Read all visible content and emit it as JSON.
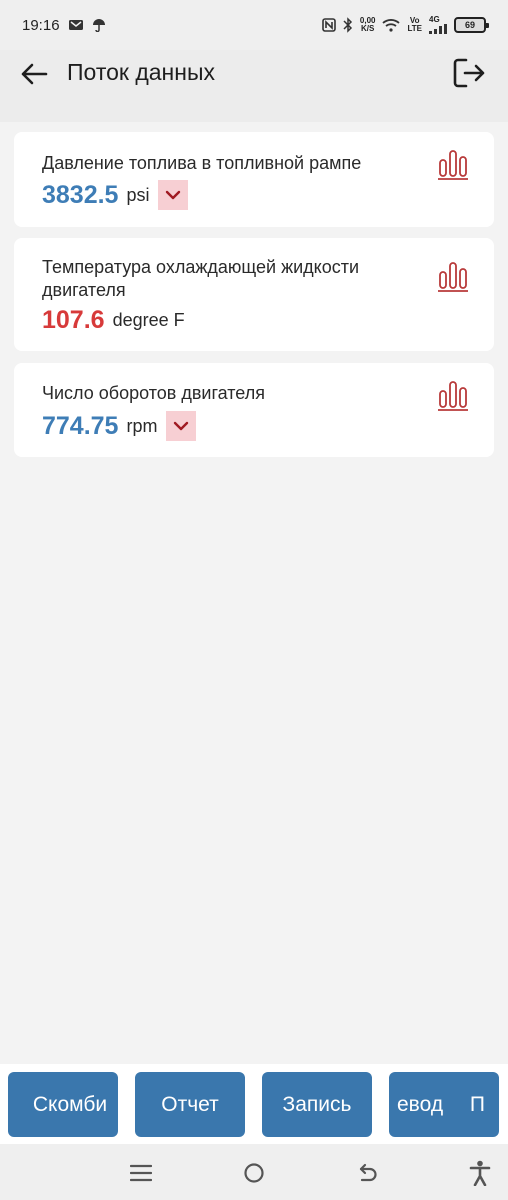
{
  "status_bar": {
    "time": "19:16",
    "net_speed_value": "0,00",
    "net_speed_unit": "K/S",
    "volte_top": "Vo",
    "volte_bottom": "LTE",
    "network": "4G",
    "battery": "69"
  },
  "header": {
    "title": "Поток данных"
  },
  "cards": [
    {
      "title": "Давление топлива в топливной рампе",
      "value": "3832.5",
      "unit": "psi",
      "value_color": "#3e7db6",
      "has_dropdown": true
    },
    {
      "title": "Температура охлаждающей жидкости двигателя",
      "value": "107.6",
      "unit": "degree F",
      "value_color": "#d73a3a",
      "has_dropdown": false
    },
    {
      "title": "Число оборотов двигателя",
      "value": "774.75",
      "unit": "rpm",
      "value_color": "#3e7db6",
      "has_dropdown": true
    }
  ],
  "bottom_buttons": {
    "combine": "Скомби",
    "report": "Отчет",
    "record": "Запись",
    "translate": "евод",
    "next": "П"
  },
  "colors": {
    "accent_blue": "#3a77ad",
    "chart_icon": "#b83a3a",
    "dropdown_bg": "#f7cfd3"
  },
  "icons": [
    "back-arrow-icon",
    "exit-icon",
    "bar-chart-icon",
    "chevron-down-icon",
    "menu-icon",
    "home-icon",
    "back-icon",
    "accessibility-icon"
  ]
}
